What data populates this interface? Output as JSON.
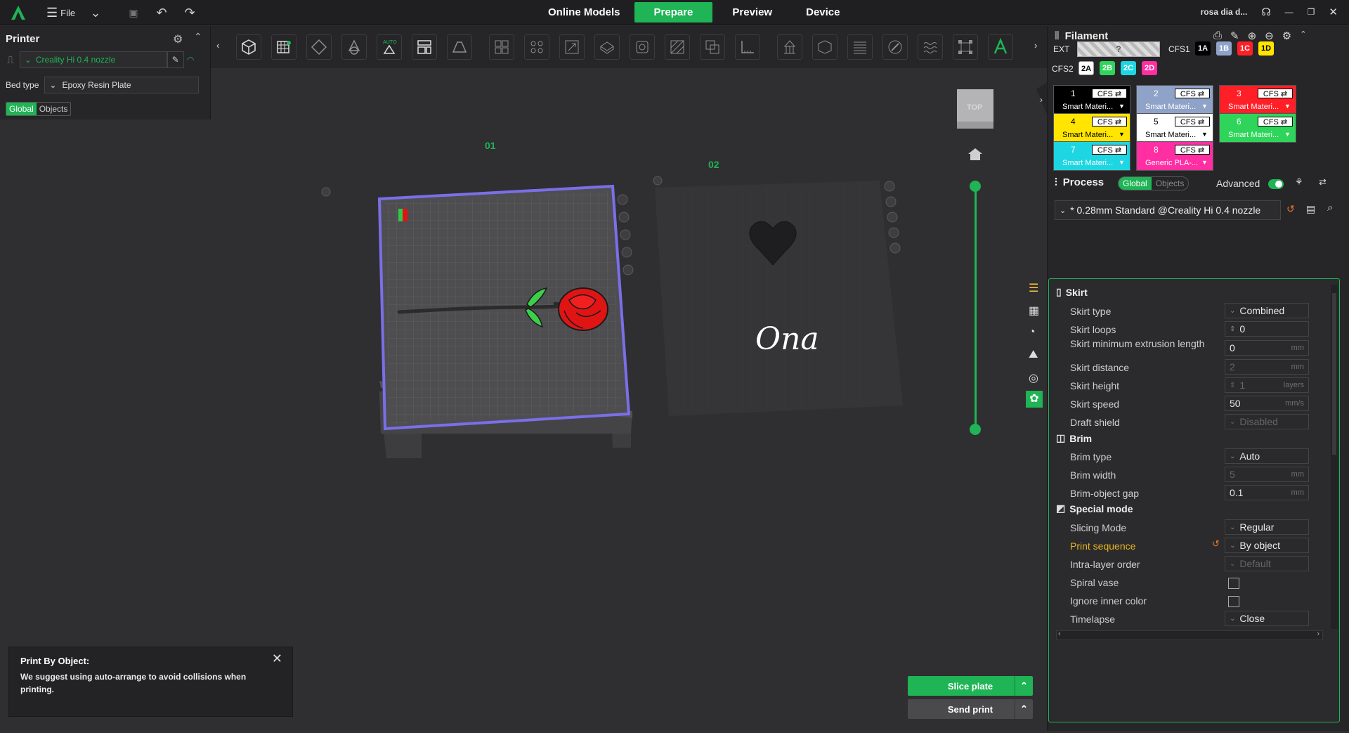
{
  "topbar": {
    "file_label": "File",
    "tabs": [
      {
        "label": "Online Models"
      },
      {
        "label": "Prepare"
      },
      {
        "label": "Preview"
      },
      {
        "label": "Device"
      }
    ],
    "project_name": "rosa dia d...",
    "accent": "#1fb455"
  },
  "printer": {
    "title": "Printer",
    "name": "Creality Hi 0.4 nozzle",
    "bed_type_label": "Bed type",
    "bed_type": "Epoxy Resin Plate",
    "seg_global": "Global",
    "seg_objects": "Objects"
  },
  "viewport": {
    "plate1_label": "01",
    "plate2_label": "02",
    "view_cube": "TOP",
    "signature_text": "Ona"
  },
  "filament": {
    "title": "Filament",
    "ext_label": "EXT",
    "ext_slot": "?",
    "cfs1_label": "CFS1",
    "cfs1_slots": [
      {
        "id": "1A",
        "color": "#000000",
        "text_color": "#ffffff"
      },
      {
        "id": "1B",
        "color": "#8fa2c8",
        "text_color": "#ffffff"
      },
      {
        "id": "1C",
        "color": "#ff1f27",
        "text_color": "#ffffff"
      },
      {
        "id": "1D",
        "color": "#ffe500",
        "text_color": "#000000"
      }
    ],
    "cfs2_label": "CFS2",
    "cfs2_slots": [
      {
        "id": "2A",
        "color": "#ffffff",
        "text_color": "#000000"
      },
      {
        "id": "2B",
        "color": "#2ed55a",
        "text_color": "#ffffff"
      },
      {
        "id": "2C",
        "color": "#1ed6e2",
        "text_color": "#ffffff"
      },
      {
        "id": "2D",
        "color": "#ff2ea2",
        "text_color": "#ffffff"
      }
    ],
    "cards": [
      {
        "num": "1",
        "badge": "CFS ⇄",
        "material": "Smart Materi...",
        "color": "#000000",
        "text_color": "#ffffff"
      },
      {
        "num": "2",
        "badge": "CFS ⇄",
        "material": "Smart Materi...",
        "color": "#8fa2c8",
        "text_color": "#ffffff"
      },
      {
        "num": "3",
        "badge": "CFS ⇄",
        "material": "Smart Materi...",
        "color": "#ff1f27",
        "text_color": "#ffffff"
      },
      {
        "num": "4",
        "badge": "CFS ⇄",
        "material": "Smart Materi...",
        "color": "#ffe500",
        "text_color": "#000000"
      },
      {
        "num": "5",
        "badge": "CFS ⇄",
        "material": "Smart Materi...",
        "color": "#ffffff",
        "text_color": "#000000"
      },
      {
        "num": "6",
        "badge": "CFS ⇄",
        "material": "Smart Materi...",
        "color": "#2ed55a",
        "text_color": "#ffffff"
      },
      {
        "num": "7",
        "badge": "CFS ⇄",
        "material": "Smart Materi...",
        "color": "#1ed6e2",
        "text_color": "#ffffff"
      },
      {
        "num": "8",
        "badge": "CFS ⇄",
        "material": "Generic PLA-...",
        "color": "#ff2ea2",
        "text_color": "#ffffff"
      }
    ]
  },
  "process": {
    "title": "Process",
    "seg_global": "Global",
    "seg_objects": "Objects",
    "advanced_label": "Advanced",
    "preset": "* 0.28mm Standard @Creality Hi 0.4 nozzle",
    "sections": {
      "skirt": "Skirt",
      "brim": "Brim",
      "special": "Special mode"
    },
    "rows": {
      "skirt_type": {
        "label": "Skirt type",
        "value": "Combined"
      },
      "skirt_loops": {
        "label": "Skirt loops",
        "value": "0"
      },
      "skirt_min_extrusion": {
        "label": "Skirt minimum extrusion length",
        "value": "0",
        "unit": "mm"
      },
      "skirt_distance": {
        "label": "Skirt distance",
        "value": "2",
        "unit": "mm"
      },
      "skirt_height": {
        "label": "Skirt height",
        "value": "1",
        "unit": "layers"
      },
      "skirt_speed": {
        "label": "Skirt speed",
        "value": "50",
        "unit": "mm/s"
      },
      "draft_shield": {
        "label": "Draft shield",
        "value": "Disabled"
      },
      "brim_type": {
        "label": "Brim type",
        "value": "Auto"
      },
      "brim_width": {
        "label": "Brim width",
        "value": "5",
        "unit": "mm"
      },
      "brim_gap": {
        "label": "Brim-object gap",
        "value": "0.1",
        "unit": "mm"
      },
      "slicing_mode": {
        "label": "Slicing Mode",
        "value": "Regular"
      },
      "print_sequence": {
        "label": "Print sequence",
        "value": "By object"
      },
      "intra_layer": {
        "label": "Intra-layer order",
        "value": "Default"
      },
      "spiral_vase": {
        "label": "Spiral vase"
      },
      "ignore_inner": {
        "label": "Ignore inner color"
      },
      "timelapse": {
        "label": "Timelapse",
        "value": "Close"
      }
    }
  },
  "notification": {
    "title": "Print By Object:",
    "body": "We suggest using auto-arrange to avoid collisions when printing."
  },
  "actions": {
    "slice": "Slice plate",
    "send": "Send print"
  }
}
